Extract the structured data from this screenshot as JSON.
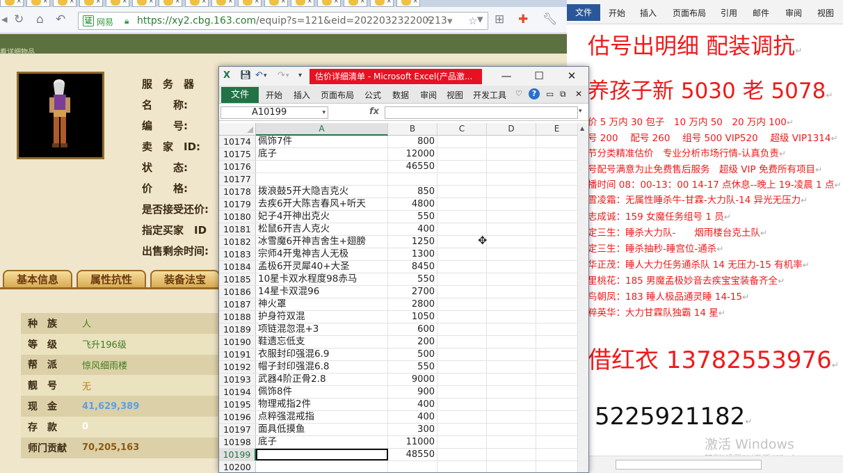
{
  "browser": {
    "url_brand": "网易",
    "url_text": "https://xy2.cbg.163.com",
    "url_rest": "/equip?s=121&eid=202203232200213",
    "breadcrumb": "看详细物品",
    "info_labels": [
      "服　务　器",
      "名　　称:",
      "编　　号:",
      "卖　家　ID:",
      "状　　态:",
      "价　　格:",
      "是否接受还价:",
      "指定买家　ID",
      "出售剩余时间:"
    ],
    "tabs": [
      "基本信息",
      "属性抗性",
      "装备法宝"
    ],
    "attributes": [
      {
        "k": "种　族",
        "v": "人",
        "color": "#3e7d1e"
      },
      {
        "k": "等　级",
        "v": "飞升196级",
        "color": "#3e7d1e"
      },
      {
        "k": "帮　派",
        "v": "惊风细雨楼",
        "color": "#3e7d1e"
      },
      {
        "k": "靓　号",
        "v": "无",
        "color": "#b8860b"
      },
      {
        "k": "现　金",
        "v": "41,629,389",
        "color": "#5aa0e0"
      },
      {
        "k": "存　款",
        "v": "0",
        "color": "#ffffff"
      },
      {
        "k": "师门贡献",
        "v": "70,205,163",
        "color": "#8a5a14"
      }
    ]
  },
  "excel": {
    "title": "估价详细清单 - Microsoft Excel(产品激...",
    "file_tab": "文件",
    "ribbon_tabs": [
      "开始",
      "插入",
      "页面布局",
      "公式",
      "数据",
      "审阅",
      "视图",
      "开发工具"
    ],
    "name_box": "A10199",
    "fx": "fx",
    "columns": [
      "A",
      "B",
      "C",
      "D",
      "E"
    ],
    "active_row": "10199",
    "rows": [
      {
        "n": "10174",
        "a": "佩饰7件",
        "b": "800"
      },
      {
        "n": "10175",
        "a": "底子",
        "b": "12000"
      },
      {
        "n": "10176",
        "a": "",
        "b": "46550"
      },
      {
        "n": "10177",
        "a": "",
        "b": ""
      },
      {
        "n": "10178",
        "a": "拨浪鼓5开大隐吉克火",
        "b": "850"
      },
      {
        "n": "10179",
        "a": "去疾6开大陈吉春风+听天",
        "b": "4800"
      },
      {
        "n": "10180",
        "a": "妃子4开神出克火",
        "b": "550"
      },
      {
        "n": "10181",
        "a": "松鼠6开吉人克火",
        "b": "400"
      },
      {
        "n": "10182",
        "a": "冰雪魔6开神吉舍生+翅膀",
        "b": "1250"
      },
      {
        "n": "10183",
        "a": "宗师4开鬼神吉人无极",
        "b": "1300"
      },
      {
        "n": "10184",
        "a": "孟极6开灵犀40+大圣",
        "b": "8450"
      },
      {
        "n": "10185",
        "a": "10星卡双水程度98赤马",
        "b": "550"
      },
      {
        "n": "10186",
        "a": "14星卡双混96",
        "b": "2700"
      },
      {
        "n": "10187",
        "a": "神火罩",
        "b": "2800"
      },
      {
        "n": "10188",
        "a": "护身符双混",
        "b": "1050"
      },
      {
        "n": "10189",
        "a": "项链混忽混+3",
        "b": "600"
      },
      {
        "n": "10190",
        "a": "鞋遗忘低支",
        "b": "200"
      },
      {
        "n": "10191",
        "a": "衣服封印强混6.9",
        "b": "500"
      },
      {
        "n": "10192",
        "a": "帽子封印强混6.8",
        "b": "550"
      },
      {
        "n": "10193",
        "a": "武器4阶正骨2.8",
        "b": "9000"
      },
      {
        "n": "10194",
        "a": "佩饰8件",
        "b": "900"
      },
      {
        "n": "10195",
        "a": "物理戒指2件",
        "b": "400"
      },
      {
        "n": "10196",
        "a": "点粹强混戒指",
        "b": "400"
      },
      {
        "n": "10197",
        "a": "面具低摸鱼",
        "b": "300"
      },
      {
        "n": "10198",
        "a": "底子",
        "b": "11000"
      },
      {
        "n": "10199",
        "a": "",
        "b": "48550"
      },
      {
        "n": "10200",
        "a": "",
        "b": ""
      }
    ]
  },
  "word": {
    "file_tab": "文件",
    "tabs": [
      "开始",
      "插入",
      "页面布局",
      "引用",
      "邮件",
      "审阅",
      "视图"
    ],
    "lines": [
      {
        "cls": "h1",
        "t": "估号出明细 配装调抗"
      },
      {
        "cls": "h2",
        "t": "养孩子新 5030 老 5078"
      },
      {
        "cls": "n",
        "t": "价 5 万内 30 包子　10 万内 50　20 万内 100"
      },
      {
        "cls": "n",
        "t": "号 200　 配号 260　 组号 500 VIP520　 超级 VIP1314"
      },
      {
        "cls": "n",
        "t": "节分类精准估价　专业分析市场行情-认真负责"
      },
      {
        "cls": "n",
        "t": "号配号满意为止免费售后服务　超级 VIP 免费所有项目"
      },
      {
        "cls": "n",
        "t": "播时间 08：00-13：00 14-17 点休息--晚上 19-凌晨 1 点"
      },
      {
        "cls": "n",
        "t": "雪凌霜：无属性睡杀牛-甘霖-大力队-14 异光无压力"
      },
      {
        "cls": "n",
        "t": "志成诚：159 女魔任务组号 1 员"
      },
      {
        "cls": "n",
        "t": "定三生：睡杀大力队-　　烟雨楼台克土队"
      },
      {
        "cls": "n",
        "t": "定三生：睡杀抽秒-睡宫位-通杀"
      },
      {
        "cls": "n",
        "t": "华正茂：睡人大力任务通杀队 14 无压力-15 有机率"
      },
      {
        "cls": "n",
        "t": "里桃花：185 男魔孟极妙音去疾宝宝装备齐全"
      },
      {
        "cls": "n",
        "t": "鸟朝凤：183 睡人极品通灵睡 14-15"
      },
      {
        "cls": "n",
        "t": "粹英华：大力甘霖队独霸 14 星"
      },
      {
        "cls": "big",
        "t": "借红衣 13782553976"
      },
      {
        "cls": "blk",
        "t": "5225921182"
      }
    ],
    "watermark_1": "激活 Windows",
    "watermark_2": "转到\"设置\"以激活 Windows。"
  },
  "colors": {
    "excel_green": "#217346",
    "excel_title_red": "#e81123",
    "word_red": "#ef1a1a",
    "word_blue": "#2b579a"
  }
}
